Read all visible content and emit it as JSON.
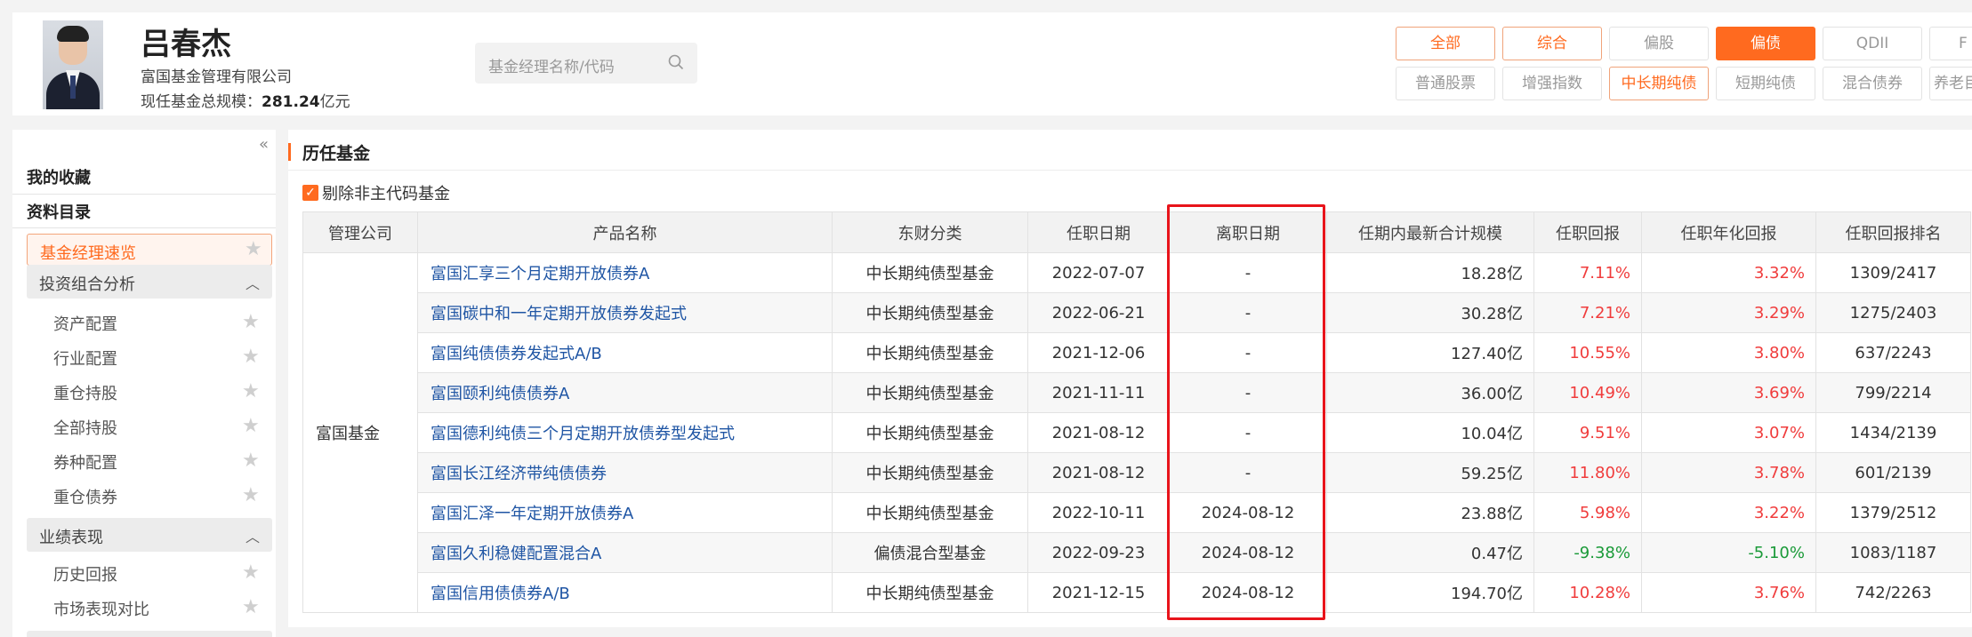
{
  "manager": {
    "name": "吕春杰",
    "company": "富国基金管理有限公司",
    "scale_label": "现任基金总规模：",
    "scale_value": "281.24",
    "scale_unit": "亿元"
  },
  "search": {
    "placeholder": "基金经理名称/代码"
  },
  "filters": {
    "row1": [
      "全部",
      "综合",
      "偏股",
      "偏债",
      "QDII",
      "F"
    ],
    "row2": [
      "普通股票",
      "增强指数",
      "中长期纯债",
      "短期纯债",
      "混合债券",
      "养老目"
    ]
  },
  "sidebar": {
    "collapse_glyph": "«",
    "favorites": "我的收藏",
    "catalog": "资料目录",
    "current": "基金经理速览",
    "group1": {
      "title": "投资组合分析",
      "items": [
        "资产配置",
        "行业配置",
        "重仓持股",
        "全部持股",
        "券种配置",
        "重仓债券"
      ]
    },
    "group2": {
      "title": "业绩表现",
      "items": [
        "历史回报",
        "市场表现对比"
      ]
    }
  },
  "main": {
    "section_title": "历任基金",
    "checkbox_label": "剔除非主代码基金",
    "columns": [
      "管理公司",
      "产品名称",
      "东财分类",
      "任职日期",
      "离职日期",
      "任期内最新合计规模",
      "任职回报",
      "任职年化回报",
      "任职回报排名"
    ],
    "company": "富国基金",
    "rows": [
      {
        "name": "富国汇享三个月定期开放债券A",
        "cat": "中长期纯债型基金",
        "start": "2022-07-07",
        "end": "-",
        "scale": "18.28亿",
        "ret": "7.11%",
        "ann": "3.32%",
        "rank": "1309/2417"
      },
      {
        "name": "富国碳中和一年定期开放债券发起式",
        "cat": "中长期纯债型基金",
        "start": "2022-06-21",
        "end": "-",
        "scale": "30.28亿",
        "ret": "7.21%",
        "ann": "3.29%",
        "rank": "1275/2403"
      },
      {
        "name": "富国纯债债券发起式A/B",
        "cat": "中长期纯债型基金",
        "start": "2021-12-06",
        "end": "-",
        "scale": "127.40亿",
        "ret": "10.55%",
        "ann": "3.80%",
        "rank": "637/2243"
      },
      {
        "name": "富国颐利纯债债券A",
        "cat": "中长期纯债型基金",
        "start": "2021-11-11",
        "end": "-",
        "scale": "36.00亿",
        "ret": "10.49%",
        "ann": "3.69%",
        "rank": "799/2214"
      },
      {
        "name": "富国德利纯债三个月定期开放债券型发起式",
        "cat": "中长期纯债型基金",
        "start": "2021-08-12",
        "end": "-",
        "scale": "10.04亿",
        "ret": "9.51%",
        "ann": "3.07%",
        "rank": "1434/2139"
      },
      {
        "name": "富国长江经济带纯债债券",
        "cat": "中长期纯债型基金",
        "start": "2021-08-12",
        "end": "-",
        "scale": "59.25亿",
        "ret": "11.80%",
        "ann": "3.78%",
        "rank": "601/2139"
      },
      {
        "name": "富国汇泽一年定期开放债券A",
        "cat": "中长期纯债型基金",
        "start": "2022-10-11",
        "end": "2024-08-12",
        "scale": "23.88亿",
        "ret": "5.98%",
        "ann": "3.22%",
        "rank": "1379/2512"
      },
      {
        "name": "富国久利稳健配置混合A",
        "cat": "偏债混合型基金",
        "start": "2022-09-23",
        "end": "2024-08-12",
        "scale": "0.47亿",
        "ret": "-9.38%",
        "ann": "-5.10%",
        "rank": "1083/1187"
      },
      {
        "name": "富国信用债债券A/B",
        "cat": "中长期纯债型基金",
        "start": "2021-12-15",
        "end": "2024-08-12",
        "scale": "194.70亿",
        "ret": "10.28%",
        "ann": "3.76%",
        "rank": "742/2263"
      }
    ]
  },
  "colors": {
    "accent": "#ff6a1f",
    "positive": "#f03c3c",
    "negative": "#1a9a38",
    "link": "#1f55a4",
    "highlight_box": "#e8141b"
  }
}
